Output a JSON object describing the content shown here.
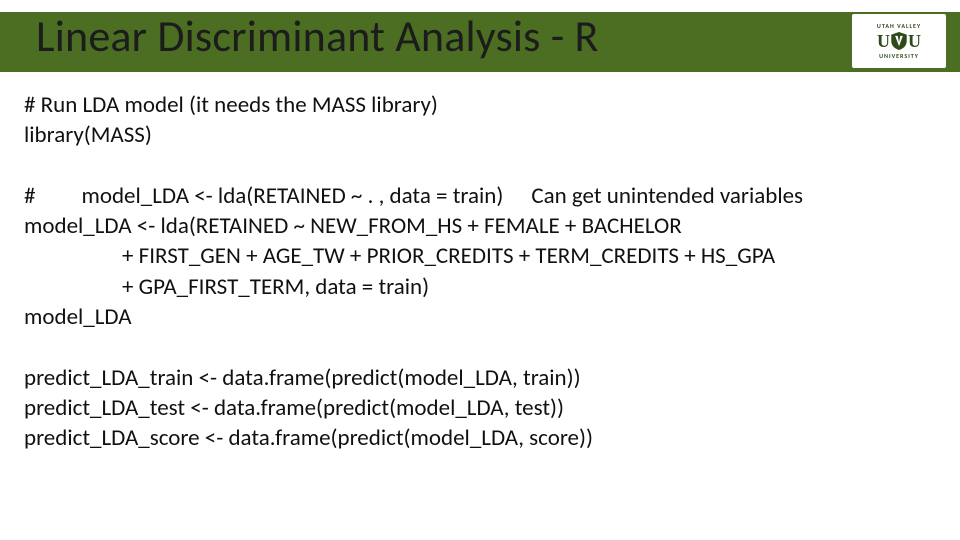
{
  "header": {
    "title": "Linear Discriminant Analysis - R",
    "logo_top": "UTAH VALLEY",
    "logo_mid": "UVU",
    "logo_bottom": "UNIVERSITY"
  },
  "body": {
    "l1": "#  Run LDA model (it needs the MASS library)",
    "l2": "library(MASS)",
    "l3a": "#",
    "l3b": "model_LDA <- lda(RETAINED ~ . , data = train)",
    "l3c": "Can get unintended variables",
    "l4": "model_LDA <- lda(RETAINED ~ NEW_FROM_HS + FEMALE + BACHELOR",
    "l5": "+ FIRST_GEN + AGE_TW + PRIOR_CREDITS + TERM_CREDITS + HS_GPA",
    "l6": "+ GPA_FIRST_TERM, data = train)",
    "l7": "model_LDA",
    "l8": "predict_LDA_train <- data.frame(predict(model_LDA, train))",
    "l9": "predict_LDA_test <- data.frame(predict(model_LDA, test))",
    "l10": "predict_LDA_score <- data.frame(predict(model_LDA, score))"
  }
}
